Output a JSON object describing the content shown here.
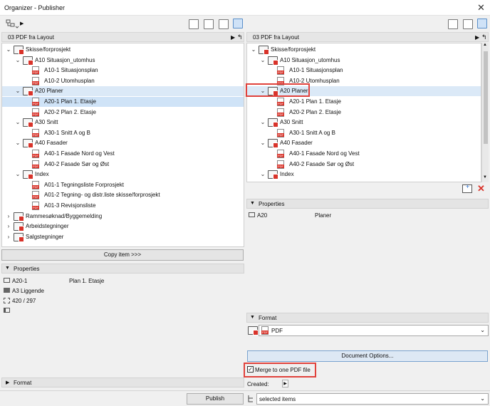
{
  "window": {
    "title": "Organizer - Publisher",
    "close_glyph": "✕"
  },
  "left": {
    "path": "03 PDF fra Layout",
    "tree": [
      {
        "label": "Skisse/forprosjekt",
        "icon": "folder",
        "level": 0,
        "expanded": true
      },
      {
        "label": "A10 Situasjon_utomhus",
        "icon": "folder",
        "level": 1,
        "expanded": true
      },
      {
        "label": "A10-1 Situasjonsplan",
        "icon": "pdf",
        "level": 2
      },
      {
        "label": "A10-2 Utomhusplan",
        "icon": "pdf",
        "level": 2
      },
      {
        "label": "A20 Planer",
        "icon": "folder",
        "level": 1,
        "expanded": true
      },
      {
        "label": "A20-1 Plan 1. Etasje",
        "icon": "pdf",
        "level": 2
      },
      {
        "label": "A20-2 Plan 2. Etasje",
        "icon": "pdf",
        "level": 2
      },
      {
        "label": "A30 Snitt",
        "icon": "folder",
        "level": 1,
        "expanded": true
      },
      {
        "label": "A30-1 Snitt A og B",
        "icon": "pdf",
        "level": 2
      },
      {
        "label": "A40 Fasader",
        "icon": "folder",
        "level": 1,
        "expanded": true
      },
      {
        "label": "A40-1 Fasade Nord og Vest",
        "icon": "pdf",
        "level": 2
      },
      {
        "label": "A40-2 Fasade Sør og Øst",
        "icon": "pdf",
        "level": 2
      },
      {
        "label": "Index",
        "icon": "folder",
        "level": 1,
        "expanded": true
      },
      {
        "label": "A01-1 Tegningsliste Forprosjekt",
        "icon": "pdf",
        "level": 2
      },
      {
        "label": "A01-2 Tegning- og distr.liste skisse/forprosjekt",
        "icon": "pdf",
        "level": 2
      },
      {
        "label": "A01-3 Revisjonsliste",
        "icon": "pdf",
        "level": 2
      },
      {
        "label": "Rammesøknad/Byggemelding",
        "icon": "folder",
        "level": 0,
        "expanded": false
      },
      {
        "label": "Arbeidstegninger",
        "icon": "folder",
        "level": 0,
        "expanded": false
      },
      {
        "label": "Salgstegninger",
        "icon": "folder",
        "level": 0,
        "expanded": false
      }
    ],
    "copy_button": "Copy item >>>",
    "properties_header": "Properties",
    "props": {
      "id": "A20-1",
      "name": "Plan 1. Etasje",
      "paper": "A3 Liggende",
      "size": "420 / 297"
    },
    "format_header": "Format"
  },
  "right": {
    "path": "03 PDF fra Layout",
    "tree": [
      {
        "label": "Skisse/forprosjekt",
        "icon": "folder",
        "level": 0,
        "expanded": true
      },
      {
        "label": "A10 Situasjon_utomhus",
        "icon": "folder",
        "level": 1,
        "expanded": true
      },
      {
        "label": "A10-1 Situasjonsplan",
        "icon": "pdf",
        "level": 2
      },
      {
        "label": "A10-2 Utomhusplan",
        "icon": "pdf",
        "level": 2
      },
      {
        "label": "A20 Planer",
        "icon": "folder",
        "level": 1,
        "expanded": true
      },
      {
        "label": "A20-1 Plan 1. Etasje",
        "icon": "pdf",
        "level": 2
      },
      {
        "label": "A20-2 Plan 2. Etasje",
        "icon": "pdf",
        "level": 2
      },
      {
        "label": "A30 Snitt",
        "icon": "folder",
        "level": 1,
        "expanded": true
      },
      {
        "label": "A30-1 Snitt A og B",
        "icon": "pdf",
        "level": 2
      },
      {
        "label": "A40 Fasader",
        "icon": "folder",
        "level": 1,
        "expanded": true
      },
      {
        "label": "A40-1 Fasade Nord og Vest",
        "icon": "pdf",
        "level": 2
      },
      {
        "label": "A40-2 Fasade Sør og Øst",
        "icon": "pdf",
        "level": 2
      },
      {
        "label": "Index",
        "icon": "folder",
        "level": 1,
        "expanded": true
      }
    ],
    "properties_header": "Properties",
    "props": {
      "id": "A20",
      "name": "Planer"
    },
    "format_header": "Format",
    "format_value": "PDF",
    "document_options": "Document Options...",
    "merge_label": "Merge to one PDF file",
    "merge_checked": true,
    "created_label": "Created:",
    "target_value": "selected items"
  },
  "publish_button": "Publish",
  "colors": {
    "selection": "#cfe3f7",
    "highlight": "#e0423c",
    "pdf_red": "#d8332a"
  }
}
